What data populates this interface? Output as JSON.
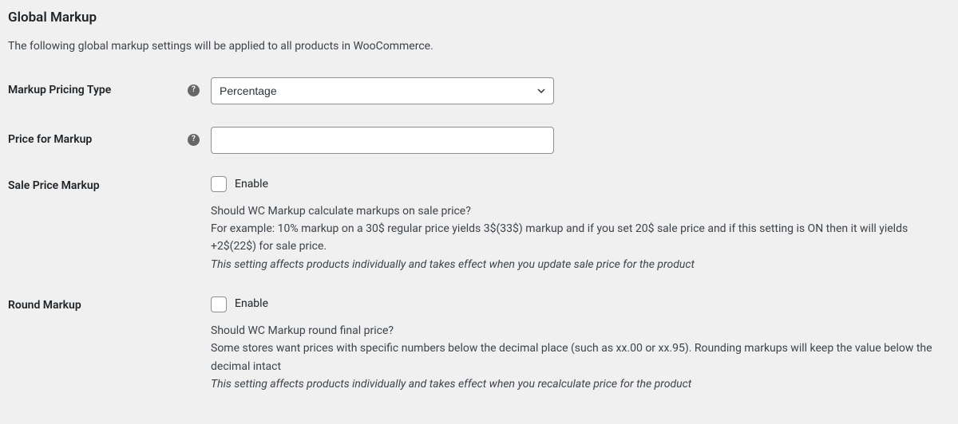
{
  "section": {
    "title": "Global Markup",
    "description": "The following global markup settings will be applied to all products in WooCommerce."
  },
  "fields": {
    "pricingType": {
      "label": "Markup Pricing Type",
      "selected": "Percentage"
    },
    "priceForMarkup": {
      "label": "Price for Markup",
      "value": ""
    },
    "salePriceMarkup": {
      "label": "Sale Price Markup",
      "checkboxLabel": "Enable",
      "descLine1": "Should WC Markup calculate markups on sale price?",
      "descLine2": "For example: 10% markup on a 30$ regular price yields 3$(33$) markup and if you set 20$ sale price and if this setting is ON then it will yields +2$(22$) for sale price.",
      "descItalic": "This setting affects products individually and takes effect when you update sale price for the product"
    },
    "roundMarkup": {
      "label": "Round Markup",
      "checkboxLabel": "Enable",
      "descLine1": "Should WC Markup round final price?",
      "descLine2": "Some stores want prices with specific numbers below the decimal place (such as xx.00 or xx.95). Rounding markups will keep the value below the decimal intact",
      "descItalic": "This setting affects products individually and takes effect when you recalculate price for the product"
    }
  }
}
